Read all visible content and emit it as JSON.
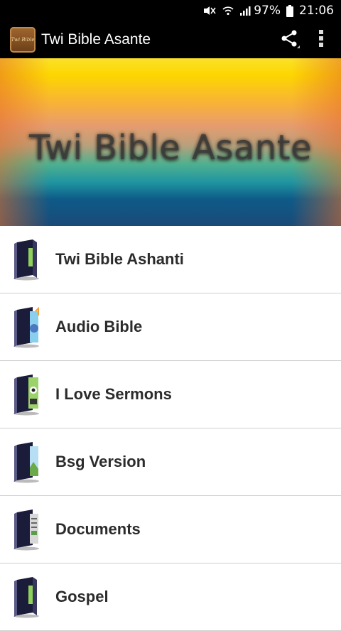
{
  "status_bar": {
    "battery": "97%",
    "time": "21:06"
  },
  "app_bar": {
    "logo_text": "Twi Bible",
    "title": "Twi Bible Asante"
  },
  "hero": {
    "title": "Twi Bible Asante"
  },
  "menu": {
    "items": [
      {
        "label": "Twi Bible Ashanti",
        "icon": "book-icon"
      },
      {
        "label": "Audio Bible",
        "icon": "audio-book-icon"
      },
      {
        "label": "I Love Sermons",
        "icon": "video-book-icon"
      },
      {
        "label": "Bsg Version",
        "icon": "image-book-icon"
      },
      {
        "label": "Documents",
        "icon": "document-book-icon"
      },
      {
        "label": "Gospel",
        "icon": "book-icon"
      }
    ]
  }
}
